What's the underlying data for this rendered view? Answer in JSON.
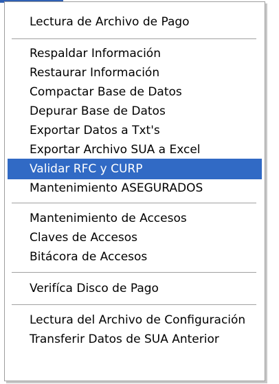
{
  "menu": {
    "items": [
      {
        "label": "Lectura de Archivo de Pago",
        "mnemonic": "L",
        "selected": false
      },
      {
        "label": "Respaldar Información",
        "mnemonic": "R",
        "selected": false
      },
      {
        "label": "Restaurar Información",
        "mnemonic": "e",
        "selected": false
      },
      {
        "label": "Compactar Base de Datos",
        "mnemonic": "B",
        "selected": false
      },
      {
        "label": "Depurar Base de Datos",
        "mnemonic": "D",
        "selected": false
      },
      {
        "label": "Exportar Datos a Txt's",
        "mnemonic": "E",
        "selected": false
      },
      {
        "label": "Exportar Archivo SUA a Excel",
        "mnemonic": "",
        "selected": false
      },
      {
        "label": "Validar RFC y CURP",
        "mnemonic": "",
        "selected": true
      },
      {
        "label": "Mantenimiento ASEGURADOS",
        "mnemonic": "",
        "selected": false
      },
      {
        "label": "Mantenimiento de Accesos",
        "mnemonic": "M",
        "selected": false
      },
      {
        "label": "Claves de Accesos",
        "mnemonic": "C",
        "selected": false
      },
      {
        "label": "Bitácora de Accesos",
        "mnemonic": "B",
        "selected": false
      },
      {
        "label": "Verifíca Disco de Pago",
        "mnemonic": "V",
        "selected": false
      },
      {
        "label": "Lectura del Archivo de Configuración",
        "mnemonic": "f",
        "selected": false
      },
      {
        "label": "Transferir Datos de SUA Anterior",
        "mnemonic": "",
        "selected": false
      }
    ]
  },
  "colors": {
    "selection": "#316ac5",
    "selection_text": "#ffffff",
    "text": "#000000",
    "menu_background": "#ffffff",
    "border": "#9d9d9d"
  }
}
